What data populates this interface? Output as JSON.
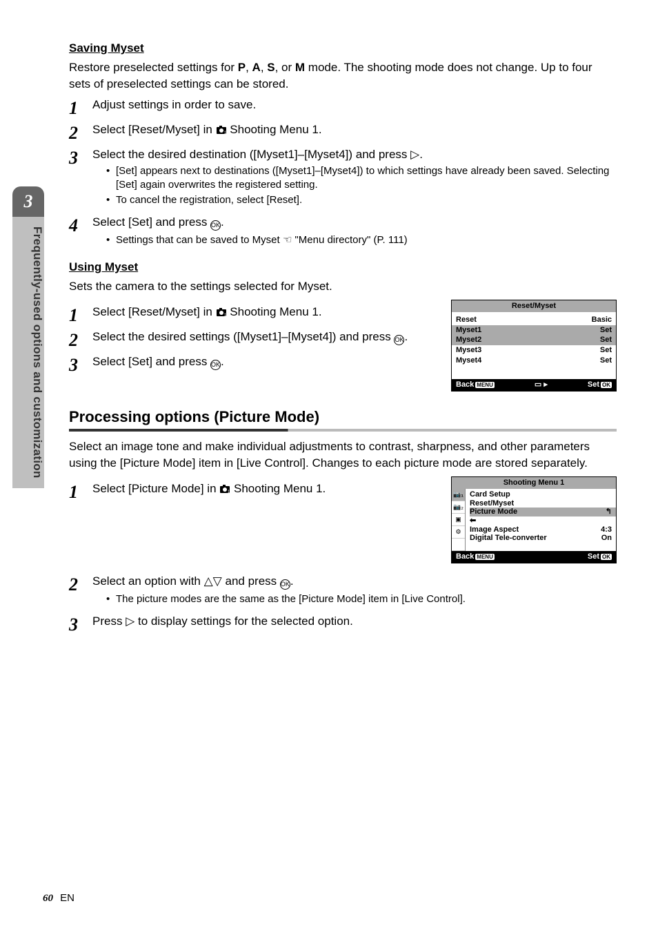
{
  "side": {
    "chapter_number": "3",
    "chapter_label": "Frequently-used options and customization"
  },
  "section_a": {
    "heading": "Saving Myset",
    "desc_line1_prefix": "Restore preselected settings for ",
    "mode_p": "P",
    "mode_a": "A",
    "mode_s": "S",
    "mode_m": "M",
    "desc_line1_mid1": ", ",
    "desc_line1_mid2": ", ",
    "desc_line1_or": ", or ",
    "desc_line1_suffix": " mode. The shooting mode does not change. Up to four sets of preselected settings can be stored.",
    "steps": [
      {
        "num": "1",
        "text": "Adjust settings in order to save."
      },
      {
        "num": "2",
        "text_pre": "Select [Reset/Myset] in ",
        "icon": "camera1",
        "text_post": " Shooting Menu 1."
      },
      {
        "num": "3",
        "text_pre": "Select the desired destination ([Myset1]–[Myset4]) and press ",
        "icon": "tri-right",
        "text_post": ".",
        "bullets": [
          "[Set] appears next to destinations ([Myset1]–[Myset4]) to which settings have already been saved. Selecting [Set] again overwrites the registered setting.",
          "To cancel the registration, select [Reset]."
        ]
      },
      {
        "num": "4",
        "text_pre": "Select [Set] and press ",
        "icon": "ok",
        "text_post": ".",
        "bullets_rich": {
          "pre": "Settings that can be saved to Myset  ",
          "icon": "hand",
          "post": "  \"Menu directory\" (P. 111)"
        }
      }
    ]
  },
  "section_b": {
    "heading": "Using Myset",
    "desc": "Sets the camera to the settings selected for Myset.",
    "steps": [
      {
        "num": "1",
        "text_pre": "Select [Reset/Myset] in ",
        "icon": "camera1",
        "text_post": " Shooting Menu 1."
      },
      {
        "num": "2",
        "text_pre": "Select the desired settings ([Myset1]–[Myset4]) and press ",
        "icon": "ok",
        "text_post": "."
      },
      {
        "num": "3",
        "text_pre": "Select [Set] and press ",
        "icon": "ok",
        "text_post": "."
      }
    ]
  },
  "screen1": {
    "title": "Reset/Myset",
    "rows": [
      {
        "l": "Reset",
        "r": "Basic",
        "sel": false
      },
      {
        "l": "Myset1",
        "r": "Set",
        "sel": true
      },
      {
        "l": "Myset2",
        "r": "Set",
        "sel": true
      },
      {
        "l": "Myset3",
        "r": "Set",
        "sel": false
      },
      {
        "l": "Myset4",
        "r": "Set",
        "sel": false
      }
    ],
    "foot_l": "Back",
    "foot_l_box": "MENU",
    "foot_m_icon": "card-next",
    "foot_r": "Set",
    "foot_r_box": "OK"
  },
  "section_c": {
    "title": "Processing options (Picture Mode)",
    "desc": "Select an image tone and make individual adjustments to contrast, sharpness, and other parameters using the [Picture Mode] item in [Live Control]. Changes to each picture mode are stored separately.",
    "steps": [
      {
        "num": "1",
        "text_pre": "Select [Picture Mode] in ",
        "icon": "camera1",
        "text_post": " Shooting Menu 1."
      }
    ],
    "steps2": [
      {
        "num": "2",
        "text_pre": "Select an option with ",
        "icon": "tri-updown",
        "text_mid": " and press ",
        "icon2": "ok",
        "text_post": ".",
        "bullets": [
          "The picture modes are the same as the [Picture Mode] item in [Live Control]."
        ]
      },
      {
        "num": "3",
        "text_pre": "Press ",
        "icon": "tri-right",
        "text_post": " to display settings for the selected option."
      }
    ]
  },
  "screen2": {
    "title": "Shooting Menu 1",
    "tabs": [
      "📷₁",
      "📷₂",
      "▣",
      "⚙"
    ],
    "rows": [
      {
        "l": "Card Setup",
        "r": ""
      },
      {
        "l": "Reset/Myset",
        "r": ""
      },
      {
        "l": "Picture Mode",
        "r": "↰",
        "hl": true
      },
      {
        "l": "⬅",
        "r": ""
      },
      {
        "l": "Image Aspect",
        "r": "4:3"
      },
      {
        "l": "Digital Tele-converter",
        "r": "On"
      }
    ],
    "foot_l": "Back",
    "foot_l_box": "MENU",
    "foot_r": "Set",
    "foot_r_box": "OK"
  },
  "footer": {
    "page_number": "60",
    "lang": "EN"
  }
}
